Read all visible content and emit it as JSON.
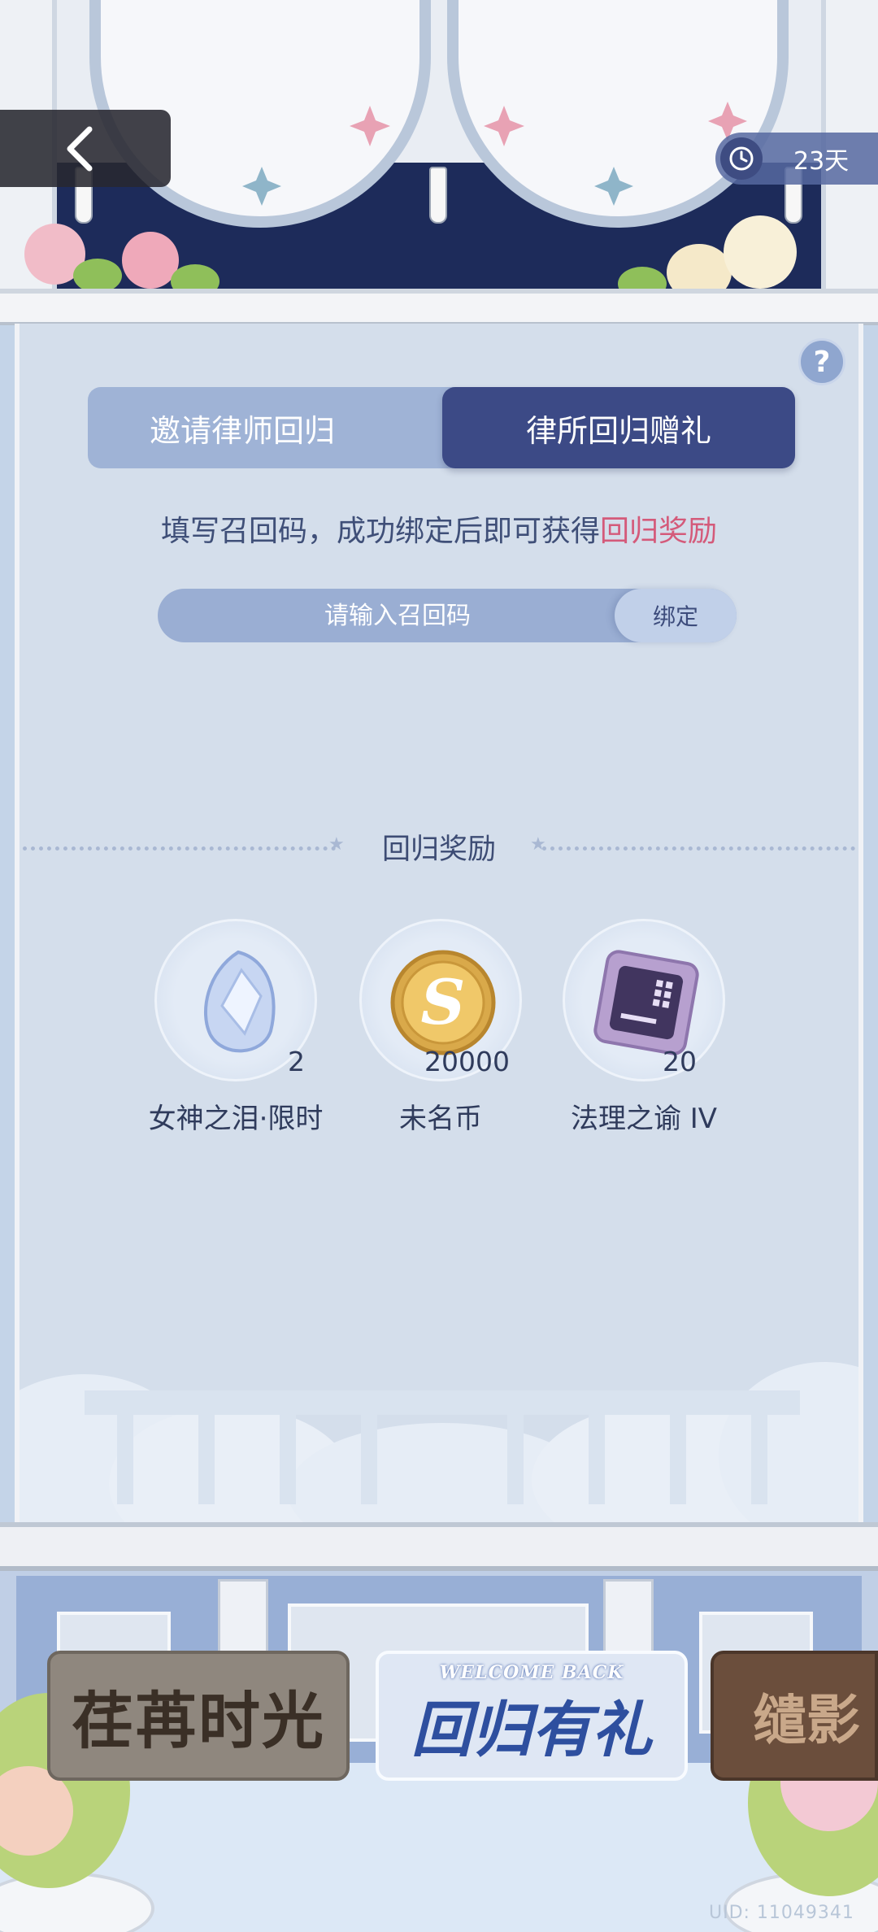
{
  "header": {
    "timer_text": "23天"
  },
  "tabs": [
    {
      "label": "邀请律师回归",
      "active": false
    },
    {
      "label": "律所回归赠礼",
      "active": true
    }
  ],
  "help_label": "?",
  "description": {
    "text": "填写召回码，成功绑定后即可获得",
    "highlight": "回归奖励"
  },
  "code_form": {
    "placeholder": "请输入召回码",
    "bind_label": "绑定"
  },
  "rewards": {
    "title": "回归奖励",
    "items": [
      {
        "name": "女神之泪·限时",
        "quantity": "2"
      },
      {
        "name": "未名币",
        "quantity": "20000"
      },
      {
        "name": "法理之谕 IV",
        "quantity": "20"
      }
    ]
  },
  "banners": [
    {
      "title": "荏苒时光"
    },
    {
      "subtitle": "WELCOME BACK",
      "title": "回归有礼"
    },
    {
      "title": "缱影"
    }
  ],
  "uid_text": "UID: 11049341",
  "colors": {
    "active_tab": "#3c4a86",
    "inactive_tab": "#9fb3d6",
    "highlight": "#d45a7a",
    "panel_bg": "#d4deeb"
  }
}
